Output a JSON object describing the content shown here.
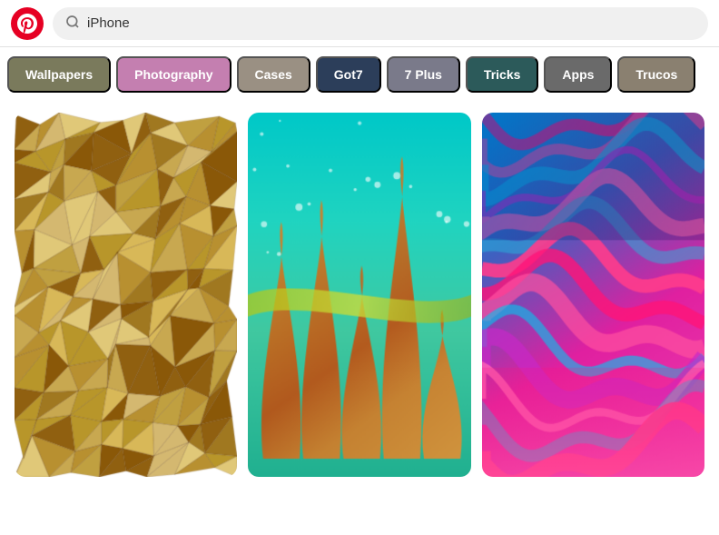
{
  "header": {
    "search_placeholder": "iPhone",
    "search_value": "iPhone"
  },
  "tags": [
    {
      "id": "wallpapers",
      "label": "Wallpapers",
      "class": "tag-wallpapers"
    },
    {
      "id": "photography",
      "label": "Photography",
      "class": "tag-photography"
    },
    {
      "id": "cases",
      "label": "Cases",
      "class": "tag-cases"
    },
    {
      "id": "got7",
      "label": "Got7",
      "class": "tag-got7"
    },
    {
      "id": "7plus",
      "label": "7 Plus",
      "class": "tag-7plus"
    },
    {
      "id": "tricks",
      "label": "Tricks",
      "class": "tag-tricks"
    },
    {
      "id": "apps",
      "label": "Apps",
      "class": "tag-apps"
    },
    {
      "id": "trucos",
      "label": "Trucos",
      "class": "tag-trucos"
    }
  ],
  "images": [
    {
      "id": "gold-poly",
      "type": "polygon",
      "alt": "Gold geometric polygonal background"
    },
    {
      "id": "fluid-teal",
      "type": "fluid-teal",
      "alt": "Teal and orange fluid art"
    },
    {
      "id": "fluid-pink",
      "type": "fluid-pink",
      "alt": "Pink and blue fluid art"
    }
  ]
}
